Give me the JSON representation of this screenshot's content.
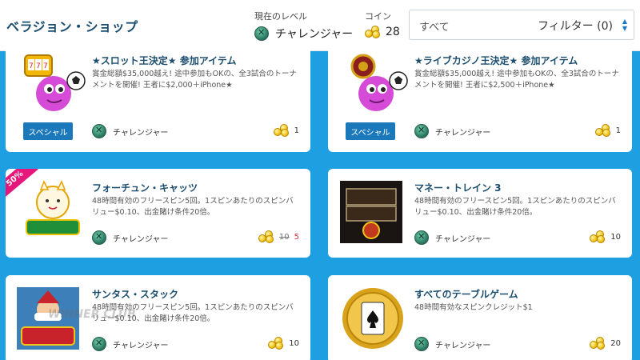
{
  "header": {
    "title": "ベラジョン・ショップ",
    "level_label": "現在のレベル",
    "level_value": "チャレンジャー",
    "coin_label": "コイン",
    "coin_value": "28",
    "filter_value": "すべて",
    "filter_button": "フィルター (0)"
  },
  "items": [
    {
      "title": "★スロット王決定★ 参加アイテム",
      "desc": "賞金総額$35,000越え! 途中参加もOKの、全3試合のトーナメントを開催! 王者に$2,000＋iPhone★",
      "level": "チャレンジャー",
      "price": "1",
      "special": "スペシャル"
    },
    {
      "title": "★ライブカジノ王決定★ 参加アイテム",
      "desc": "賞金総額$35,000越え! 途中参加もOKの、全3試合のトーナメントを開催! 王者に$2,500＋iPhone★",
      "level": "チャレンジャー",
      "price": "1",
      "special": "スペシャル"
    },
    {
      "title": "フォーチュン・キャッツ",
      "desc": "48時間有効のフリースピン5回。1スピンあたりのスピンバリュー$0.10、出金賭け条件20倍。",
      "level": "チャレンジャー",
      "old_price": "10",
      "price": "5",
      "sale": "50%",
      "thumb_text": "FORTUNE CATS GOLDEN STACKS"
    },
    {
      "title": "マネー・トレイン 3",
      "desc": "48時間有効のフリースピン5回。1スピンあたりのスピンバリュー$0.10、出金賭け条件20倍。",
      "level": "チャレンジャー",
      "price": "10",
      "thumb_text": "MONEY TRAIN 3"
    },
    {
      "title": "サンタス・スタック",
      "desc": "48時間有効のフリースピン5回。1スピンあたりのスピンバリュー$0.10、出金賭け条件20倍。",
      "level": "チャレンジャー",
      "price": "10",
      "thumb_text": "SANTA'S STACK"
    },
    {
      "title": "すべてのテーブルゲーム",
      "desc": "48時間有効なスピンクレジット$1",
      "level": "チャレンジャー",
      "price": "20"
    }
  ],
  "watermark": "WINNER CLUB",
  "colors": {
    "background": "#1d9fe2",
    "title": "#1b4d6e",
    "special_button": "#1a78bb",
    "sale_ribbon": "#e5177b",
    "discount_price": "#d0323c"
  },
  "icons": [
    "challenger-badge-icon",
    "coin-stack-icon",
    "select-arrows-icon"
  ]
}
